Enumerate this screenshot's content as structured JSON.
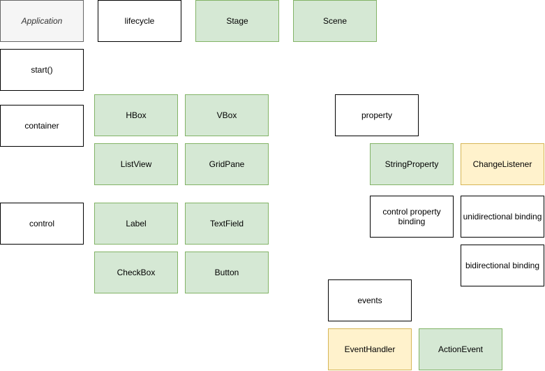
{
  "diagram": {
    "nodes": {
      "application": "Application",
      "lifecycle": "lifecycle",
      "stage": "Stage",
      "scene": "Scene",
      "start": "start()",
      "container": "container",
      "hbox": "HBox",
      "vbox": "VBox",
      "listview": "ListView",
      "gridpane": "GridPane",
      "control": "control",
      "label": "Label",
      "textfield": "TextField",
      "checkbox": "CheckBox",
      "button": "Button",
      "property": "property",
      "string_property": "StringProperty",
      "change_listener": "ChangeListener",
      "control_property_binding": "control property binding",
      "unidirectional_binding": "unidirectional binding",
      "bidirectional_binding": "bidirectional binding",
      "events": "events",
      "event_handler": "EventHandler",
      "action_event": "ActionEvent"
    },
    "colors": {
      "default_fill": "#ffffff",
      "default_stroke": "#000000",
      "green_fill": "#d5e8d4",
      "green_stroke": "#82b366",
      "yellow_fill": "#fff2cc",
      "yellow_stroke": "#d6b656",
      "gray_fill": "#f5f5f5",
      "gray_stroke": "#666666"
    }
  }
}
